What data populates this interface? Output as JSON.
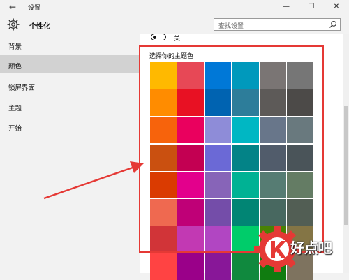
{
  "window": {
    "title": "设置",
    "back_glyph": "←",
    "minimize_glyph": "—",
    "maximize_glyph": "☐",
    "close_glyph": "✕"
  },
  "header": {
    "title": "个性化",
    "icon": "gear-icon"
  },
  "search": {
    "placeholder": "查找设置",
    "icon": "search-icon"
  },
  "sidebar": {
    "items": [
      {
        "label": "背景",
        "selected": false
      },
      {
        "label": "颜色",
        "selected": true
      },
      {
        "label": "锁屏界面",
        "selected": false
      },
      {
        "label": "主题",
        "selected": false
      },
      {
        "label": "开始",
        "selected": false
      }
    ]
  },
  "content": {
    "toggle_label": "关",
    "toggle_on": false,
    "swatch_title": "选择你的主题色",
    "swatches": [
      [
        "#FFB900",
        "#E74856",
        "#0078D7",
        "#0099BC",
        "#7A7574",
        "#767676"
      ],
      [
        "#FF8C00",
        "#E81123",
        "#0063B1",
        "#2D7D9A",
        "#5D5A58",
        "#4C4A48"
      ],
      [
        "#F7630C",
        "#EA005E",
        "#8E8CD8",
        "#00B7C3",
        "#68768A",
        "#69797E"
      ],
      [
        "#CA5010",
        "#C30052",
        "#6B69D6",
        "#038387",
        "#515C6B",
        "#4A5459"
      ],
      [
        "#DA3B01",
        "#E3008C",
        "#8764B8",
        "#00B294",
        "#567C73",
        "#647C64"
      ],
      [
        "#EF6950",
        "#BF0077",
        "#744DA9",
        "#018574",
        "#486860",
        "#525E54"
      ],
      [
        "#D13438",
        "#C239B3",
        "#B146C2",
        "#00CC6A",
        "#498205",
        "#847545"
      ],
      [
        "#FF4343",
        "#9A0089",
        "#881798",
        "#10893E",
        "#107C10",
        "#7E735F"
      ]
    ]
  },
  "annotation": {
    "arrow_color": "#E53935",
    "box_color": "#E53935"
  },
  "watermark": {
    "text": "好点吧",
    "brand_color": "#E53935"
  }
}
